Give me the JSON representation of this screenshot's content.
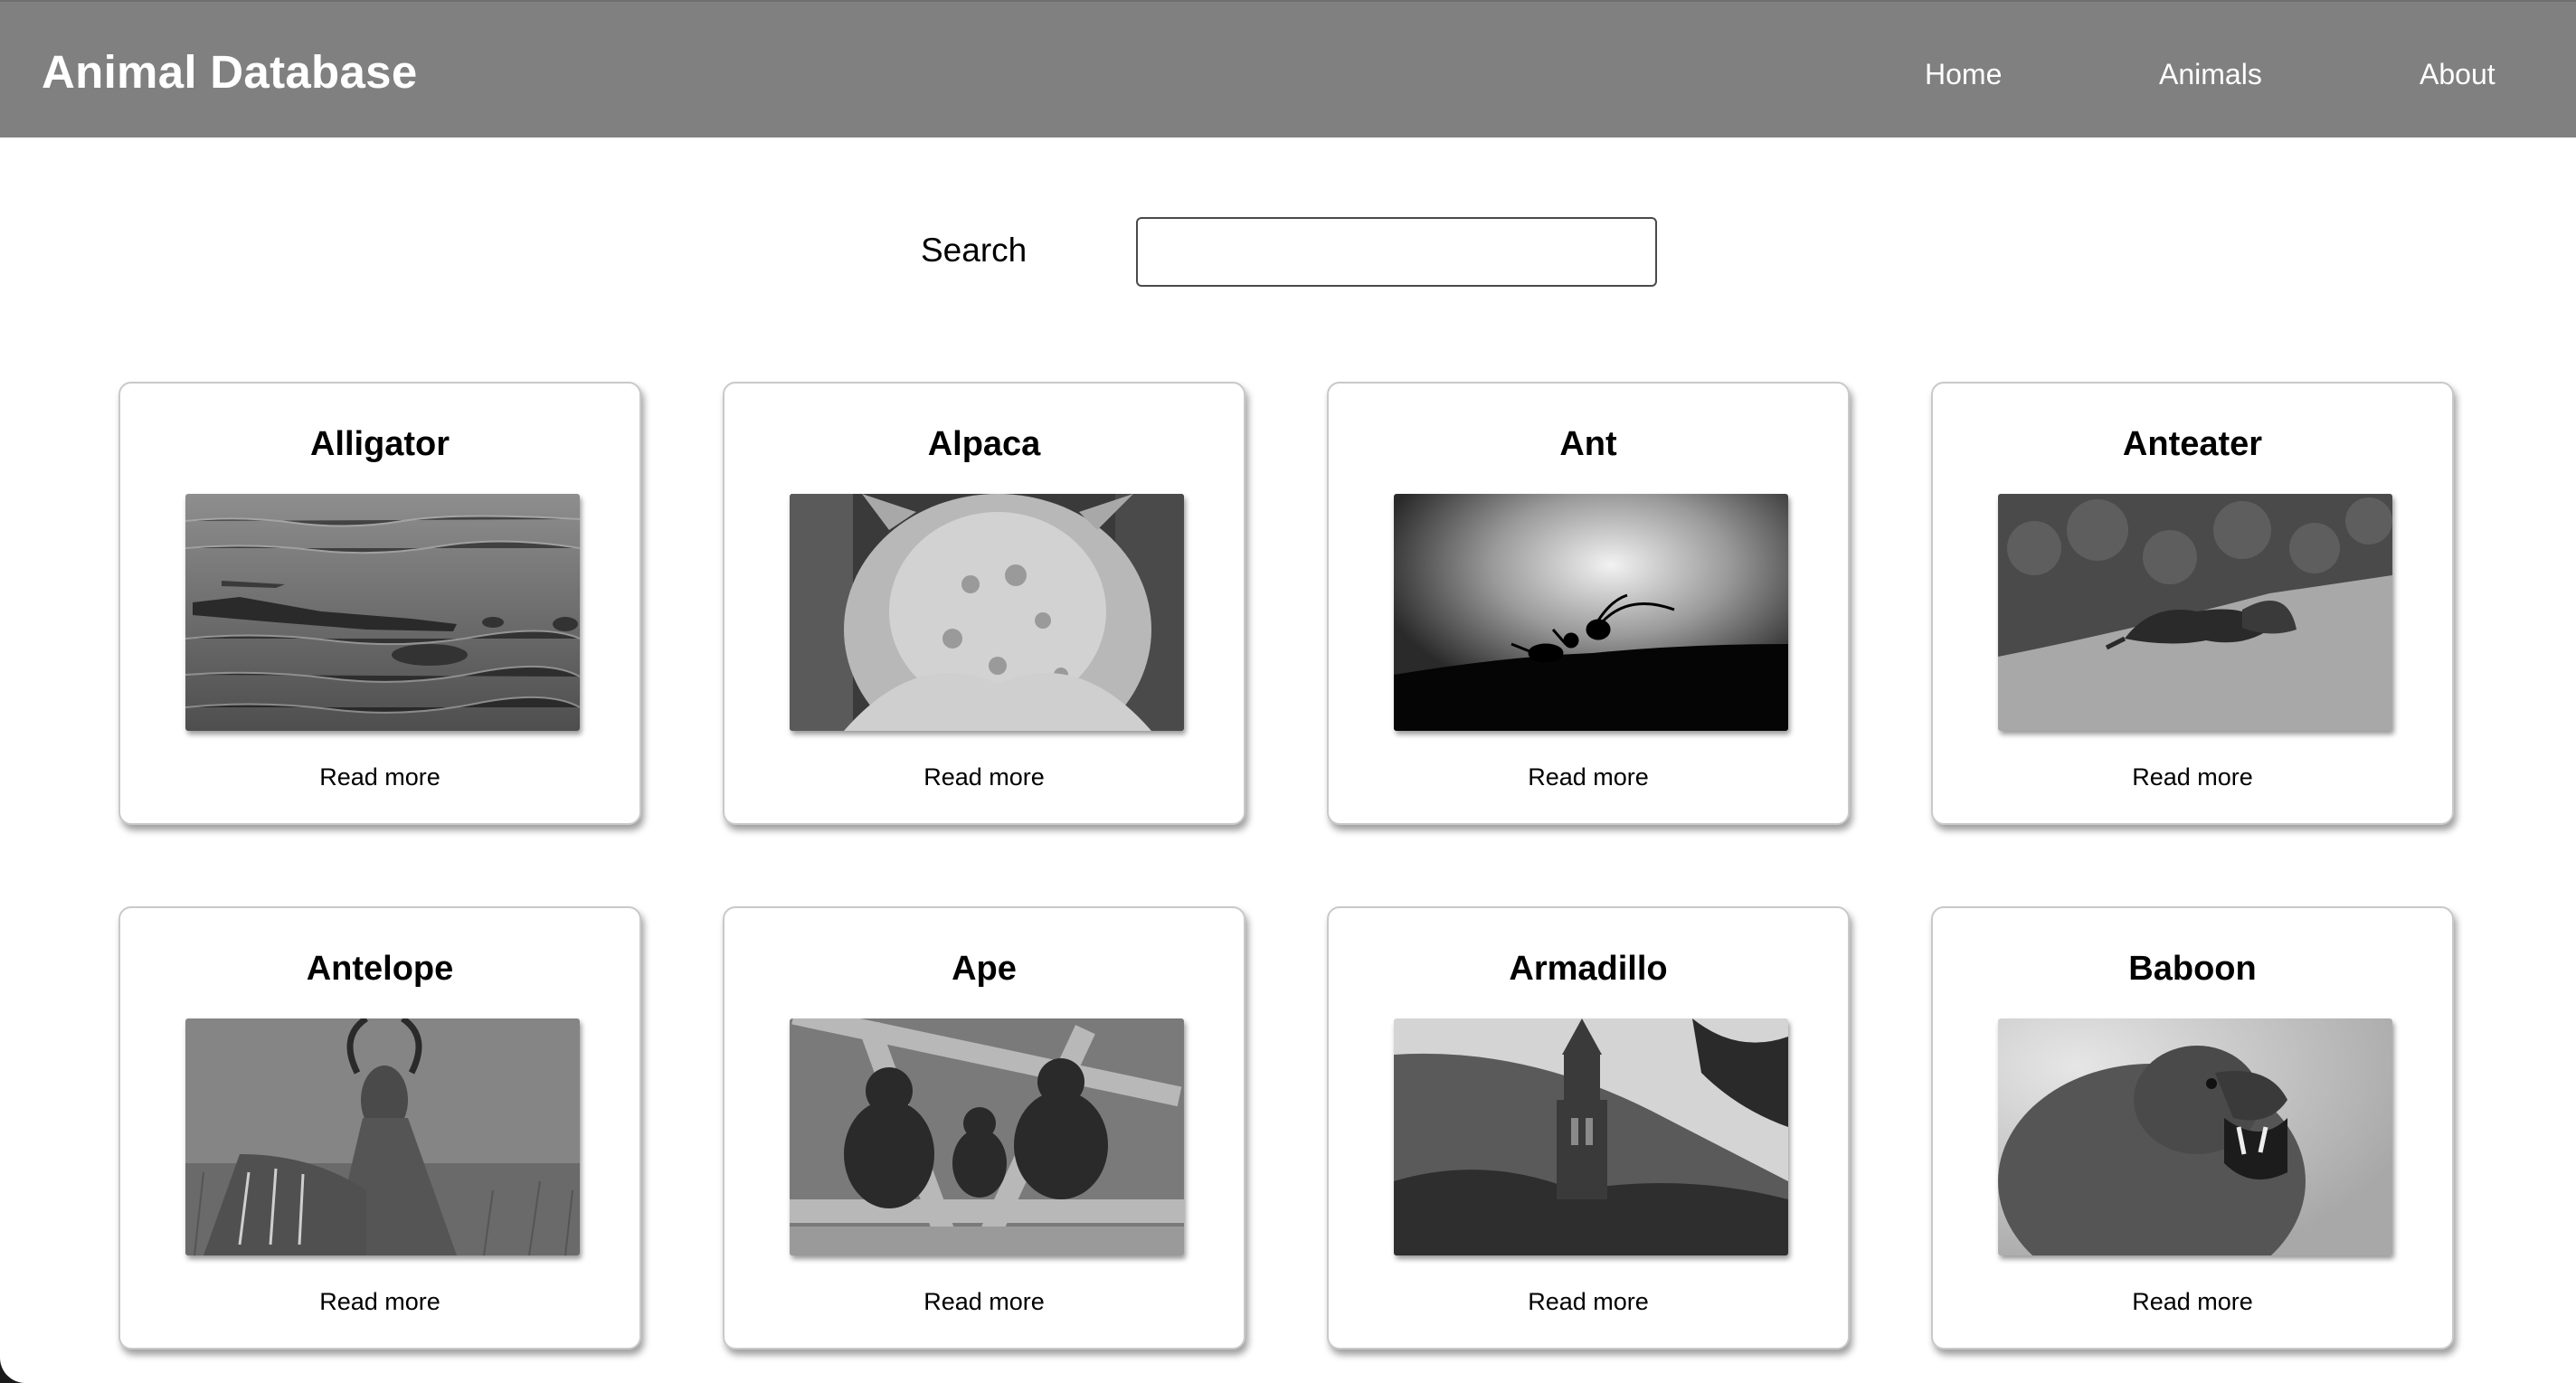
{
  "header": {
    "brand": "Animal Database",
    "nav": [
      "Home",
      "Animals",
      "About"
    ]
  },
  "search": {
    "label": "Search",
    "value": "",
    "placeholder": ""
  },
  "cards": [
    {
      "title": "Alligator",
      "link": "Read more",
      "image": "alligator-photo"
    },
    {
      "title": "Alpaca",
      "link": "Read more",
      "image": "alpaca-photo"
    },
    {
      "title": "Ant",
      "link": "Read more",
      "image": "ant-photo"
    },
    {
      "title": "Anteater",
      "link": "Read more",
      "image": "anteater-photo"
    },
    {
      "title": "Antelope",
      "link": "Read more",
      "image": "antelope-photo"
    },
    {
      "title": "Ape",
      "link": "Read more",
      "image": "ape-photo"
    },
    {
      "title": "Armadillo",
      "link": "Read more",
      "image": "armadillo-photo"
    },
    {
      "title": "Baboon",
      "link": "Read more",
      "image": "baboon-photo"
    }
  ],
  "colors": {
    "navbar": "#808080",
    "page": "#ffffff",
    "card_border": "#c9c9c9"
  }
}
